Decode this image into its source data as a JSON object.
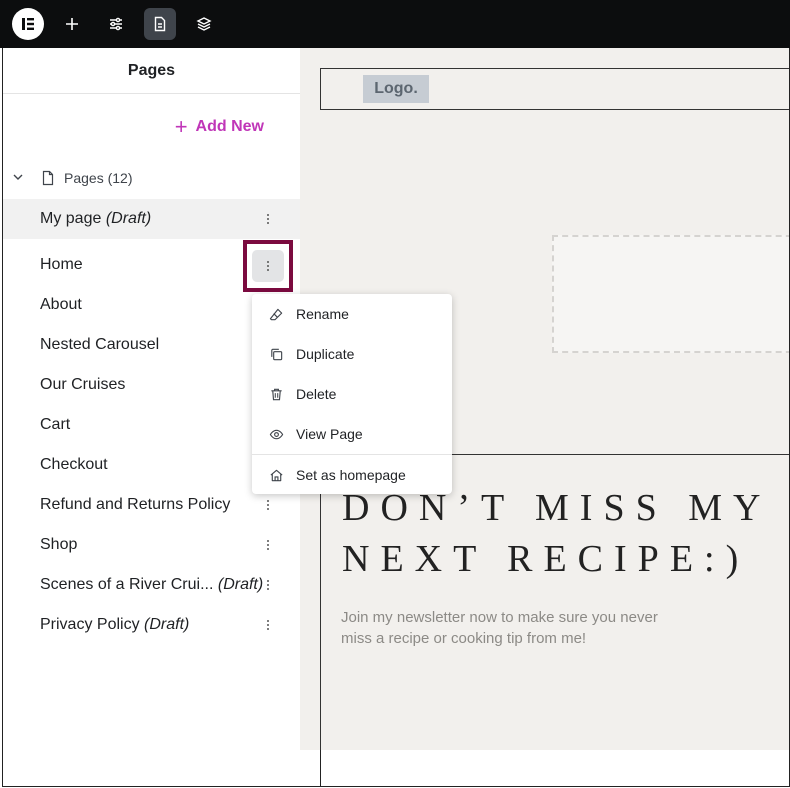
{
  "topbar": {
    "logo_icon": "elementor-logo-icon",
    "buttons": [
      "add-element-icon",
      "site-settings-icon",
      "pages-icon",
      "structure-icon"
    ]
  },
  "panel": {
    "title": "Pages",
    "add_new_label": "Add New",
    "tree_label": "Pages (12)",
    "pages": [
      {
        "name": "My page",
        "draft": "(Draft)"
      },
      {
        "name": "Home",
        "draft": ""
      },
      {
        "name": "About",
        "draft": ""
      },
      {
        "name": "Nested Carousel",
        "draft": ""
      },
      {
        "name": "Our Cruises",
        "draft": ""
      },
      {
        "name": "Cart",
        "draft": ""
      },
      {
        "name": "Checkout",
        "draft": ""
      },
      {
        "name": "Refund and Returns Policy",
        "draft": ""
      },
      {
        "name": "Shop",
        "draft": ""
      },
      {
        "name": "Scenes of a River Crui...",
        "draft": "(Draft)"
      },
      {
        "name": "Privacy Policy",
        "draft": "(Draft)"
      }
    ]
  },
  "menu": {
    "rename": "Rename",
    "duplicate": "Duplicate",
    "delete": "Delete",
    "view_page": "View Page",
    "set_homepage": "Set as homepage"
  },
  "canvas": {
    "logo_text": "Logo.",
    "headline_line1": "DON’T MISS MY",
    "headline_line2": "NEXT RECIPE:)",
    "subtext_line1": "Join my newsletter now to make sure you never",
    "subtext_line2": "miss a recipe or cooking tip from me!"
  },
  "colors": {
    "accent": "#c036b8",
    "highlight": "#7b0a3f",
    "topbar": "#0c0d0e",
    "canvas_bg": "#f2f0ed"
  }
}
